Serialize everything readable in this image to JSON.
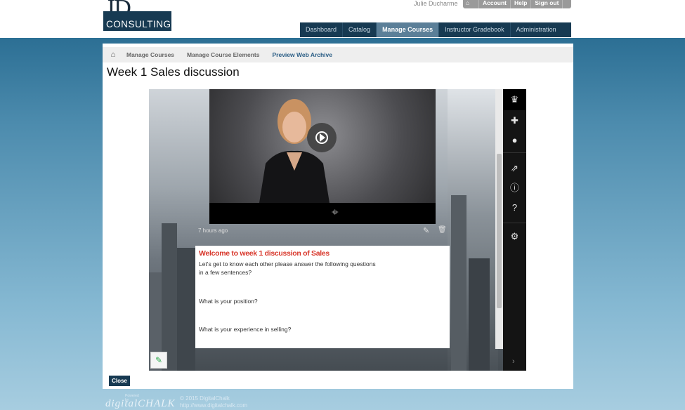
{
  "header": {
    "logo_letters": "JD",
    "logo_word": "CONSULTING",
    "username": "Julie Ducharme",
    "account_links": [
      "Account",
      "Help",
      "Sign out"
    ],
    "nav_tabs": [
      {
        "label": "Dashboard",
        "active": false
      },
      {
        "label": "Catalog",
        "active": false
      },
      {
        "label": "Manage Courses",
        "active": true
      },
      {
        "label": "Instructor Gradebook",
        "active": false
      },
      {
        "label": "Administration",
        "active": false
      }
    ]
  },
  "breadcrumb": [
    "Manage Courses",
    "Manage Course Elements",
    "Preview Web Archive"
  ],
  "page_title": "Week 1 Sales discussion",
  "post": {
    "time_ago": "7 hours ago",
    "heading": "Welcome to week 1 discussion of Sales",
    "intro_1": "Let's get to know each other please answer the following questions",
    "intro_2": "in a few sentences?",
    "question_1": "What is your position?",
    "question_2": "What is your experience in selling?"
  },
  "sidebar_icons": [
    "crown-icon",
    "plus-icon",
    "user-icon",
    "share-icon",
    "info-icon",
    "help-icon",
    "gear-icon"
  ],
  "close_label": "Close",
  "footer": {
    "powered_by": "Powered by",
    "brand": "digitalCHALK",
    "copyright": "© 2015 DigitalChalk",
    "url": "http://www.digitalchalk.com"
  },
  "colors": {
    "nav_bg": "#173a52",
    "nav_active": "#5b7f98",
    "post_heading": "#d8362a",
    "page_bg": "#7fb2cc"
  }
}
